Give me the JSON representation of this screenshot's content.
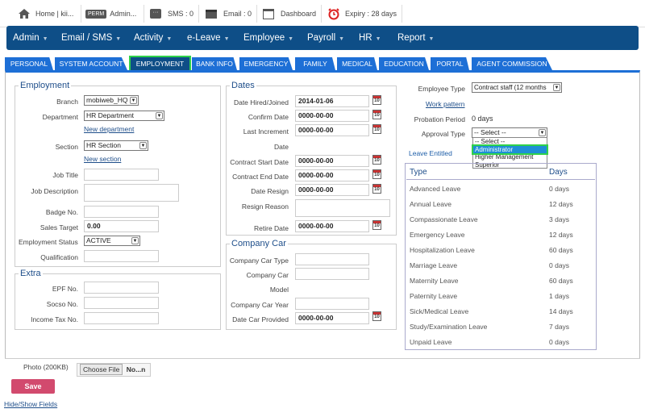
{
  "topbar": {
    "home": "Home | kii...",
    "perm_badge": "PERM",
    "admin": "Admin...",
    "sms": "SMS : 0",
    "email": "Email : 0",
    "dashboard": "Dashboard",
    "expiry": "Expiry : 28 days"
  },
  "nav": [
    "Admin",
    "Email / SMS",
    "Activity",
    "e-Leave",
    "Employee",
    "Payroll",
    "HR",
    "Report"
  ],
  "tabs": [
    "PERSONAL",
    "SYSTEM ACCOUNT",
    "EMPLOYMENT",
    "BANK INFO",
    "EMERGENCY",
    "FAMILY",
    "MEDICAL",
    "EDUCATION",
    "PORTAL",
    "AGENT COMMISSION"
  ],
  "employment": {
    "legend": "Employment",
    "branch_label": "Branch",
    "branch_value": "mobiweb_HQ",
    "department_label": "Department",
    "department_value": "HR Department",
    "new_department": "New department",
    "section_label": "Section",
    "section_value": "HR Section",
    "new_section": "New section",
    "job_title_label": "Job Title",
    "job_description_label": "Job Description",
    "badge_label": "Badge No.",
    "sales_target_label": "Sales Target",
    "sales_target_value": "0.00",
    "status_label": "Employment Status",
    "status_value": "ACTIVE",
    "qualification_label": "Qualification"
  },
  "extra": {
    "legend": "Extra",
    "epf_label": "EPF No.",
    "socso_label": "Socso No.",
    "tax_label": "Income Tax No."
  },
  "dates": {
    "legend": "Dates",
    "hired_label": "Date Hired/Joined",
    "hired_value": "2014-01-06",
    "confirm_label": "Confirm Date",
    "confirm_value": "0000-00-00",
    "last_inc_label": "Last Increment",
    "last_inc_label2": "Date",
    "last_inc_value": "0000-00-00",
    "contract_start_label": "Contract Start Date",
    "contract_start_value": "0000-00-00",
    "contract_end_label": "Contract End Date",
    "contract_end_value": "0000-00-00",
    "resign_label": "Date Resign",
    "resign_value": "0000-00-00",
    "resign_reason_label": "Resign Reason",
    "retire_label": "Retire Date",
    "retire_value": "0000-00-00"
  },
  "car": {
    "legend": "Company Car",
    "type_label": "Company Car Type",
    "model_label": "Company Car",
    "model_label2": "Model",
    "year_label": "Company Car Year",
    "date_label": "Date Car Provided",
    "date_value": "0000-00-00"
  },
  "right": {
    "emp_type_label": "Employee Type",
    "emp_type_value": "Contract staff (12 months",
    "work_pattern": "Work pattern",
    "probation_label": "Probation Period",
    "probation_value": "0 days",
    "approval_label": "Approval Type",
    "approval_value": "-- Select --",
    "dropdown_options": [
      "-- Select --",
      "Administrator",
      "Higher Management",
      "Superior"
    ],
    "leave_entitled": "Leave Entitled"
  },
  "leave_table": {
    "col_type": "Type",
    "col_days": "Days",
    "rows": [
      {
        "type": "Advanced Leave",
        "days": "0 days"
      },
      {
        "type": "Annual Leave",
        "days": "12 days"
      },
      {
        "type": "Compassionate Leave",
        "days": "3 days"
      },
      {
        "type": "Emergency Leave",
        "days": "12 days"
      },
      {
        "type": "Hospitalization Leave",
        "days": "60 days"
      },
      {
        "type": "Marriage Leave",
        "days": "0 days"
      },
      {
        "type": "Maternity Leave",
        "days": "60 days"
      },
      {
        "type": "Paternity Leave",
        "days": "1 days"
      },
      {
        "type": "Sick/Medical Leave",
        "days": "14 days"
      },
      {
        "type": "Study/Examination Leave",
        "days": "7 days"
      },
      {
        "type": "Unpaid Leave",
        "days": "0 days"
      }
    ]
  },
  "bottom": {
    "photo_label": "Photo (200KB)",
    "choose_file": "Choose File",
    "file_name": "No...n",
    "save": "Save",
    "hide_show": "Hide/Show Fields"
  },
  "colors": {
    "nav": "#0e4e87",
    "tab": "#1d6fd6",
    "highlight": "#2fd14a",
    "save": "#d24a6e"
  }
}
